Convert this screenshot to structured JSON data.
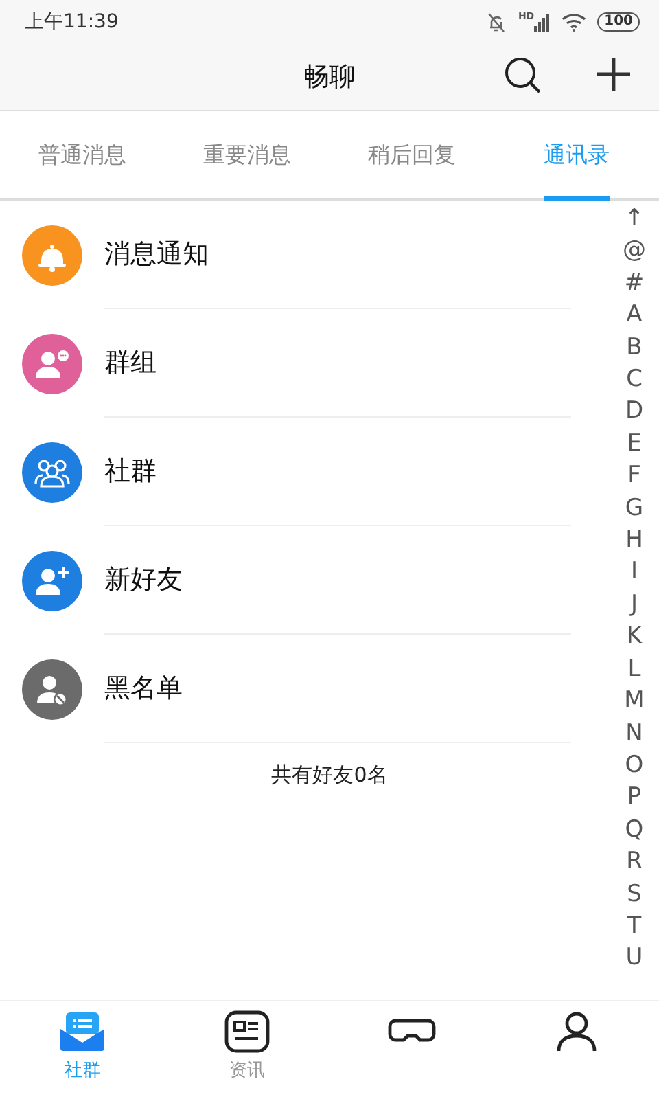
{
  "status_bar": {
    "time": "上午11:39",
    "network": "HD",
    "battery": "100"
  },
  "header": {
    "title": "畅聊"
  },
  "tabs": [
    {
      "label": "普通消息",
      "selected": false
    },
    {
      "label": "重要消息",
      "selected": false
    },
    {
      "label": "稍后回复",
      "selected": false
    },
    {
      "label": "通讯录",
      "selected": true
    }
  ],
  "contacts": [
    {
      "kind": "bell",
      "label": "消息通知",
      "color": "#f7931e"
    },
    {
      "kind": "group",
      "label": "群组",
      "color": "#e0609a"
    },
    {
      "kind": "community",
      "label": "社群",
      "color": "#1e7fe0"
    },
    {
      "kind": "add",
      "label": "新好友",
      "color": "#1e7fe0"
    },
    {
      "kind": "block",
      "label": "黑名单",
      "color": "#6b6b6b"
    }
  ],
  "friend_count": "共有好友0名",
  "index_bar": [
    "↑",
    "@",
    "#",
    "A",
    "B",
    "C",
    "D",
    "E",
    "F",
    "G",
    "H",
    "I",
    "J",
    "K",
    "L",
    "M",
    "N",
    "O",
    "P",
    "Q",
    "R",
    "S",
    "T",
    "U"
  ],
  "bottom_nav": [
    {
      "kind": "community",
      "label": "社群",
      "selected": true
    },
    {
      "kind": "news",
      "label": "资讯",
      "selected": false
    },
    {
      "kind": "game",
      "selected": false
    },
    {
      "kind": "person",
      "selected": false
    }
  ]
}
